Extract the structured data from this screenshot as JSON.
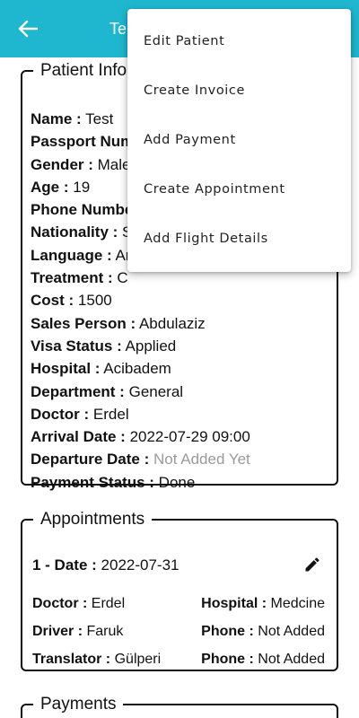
{
  "appbar": {
    "title": "Te"
  },
  "menu": {
    "items": [
      {
        "label": "Edit Patient"
      },
      {
        "label": "Create Invoice"
      },
      {
        "label": "Add Payment"
      },
      {
        "label": "Create Appointment"
      },
      {
        "label": "Add Flight Details"
      }
    ]
  },
  "patient_info": {
    "legend": "Patient Info",
    "rows": [
      {
        "label": "Name :",
        "value": "Test"
      },
      {
        "label": "Passport Number :",
        "value": ""
      },
      {
        "label": "Gender :",
        "value": "Male"
      },
      {
        "label": "Age :",
        "value": "19"
      },
      {
        "label": "Phone Number :",
        "value": ""
      },
      {
        "label": "Nationality :",
        "value": "S"
      },
      {
        "label": "Language :",
        "value": "Ar"
      },
      {
        "label": "Treatment :",
        "value": "C"
      },
      {
        "label": "Cost :",
        "value": "1500"
      },
      {
        "label": "Sales Person :",
        "value": "Abdulaziz"
      },
      {
        "label": "Visa Status :",
        "value": "Applied"
      },
      {
        "label": "Hospital :",
        "value": "Acibadem"
      },
      {
        "label": "Department :",
        "value": "General"
      },
      {
        "label": "Doctor :",
        "value": "Erdel"
      },
      {
        "label": "Arrival Date :",
        "value": "2022-07-29 09:00"
      },
      {
        "label": "Departure Date :",
        "value": "Not Added Yet"
      },
      {
        "label": "Payment Status :",
        "value": "Done"
      }
    ]
  },
  "appointments": {
    "legend": "Appointments",
    "entry": {
      "date_label": "1 - Date :",
      "date_value": "2022-07-31",
      "doctor_label": "Doctor :",
      "doctor_value": "Erdel",
      "hospital_label": "Hospital :",
      "hospital_value": "Medcine",
      "driver_label": "Driver :",
      "driver_value": "Faruk",
      "phone1_label": "Phone :",
      "phone1_value": "Not Added",
      "translator_label": "Translator :",
      "translator_value": "Gülperi",
      "phone2_label": "Phone :",
      "phone2_value": "Not Added"
    }
  },
  "payments": {
    "legend": "Payments"
  },
  "icons": {
    "back": "arrow-left-icon",
    "edit": "pencil-icon"
  },
  "colors": {
    "appbar": "#1fb7cf",
    "muted_text": "#9a9a9a"
  }
}
